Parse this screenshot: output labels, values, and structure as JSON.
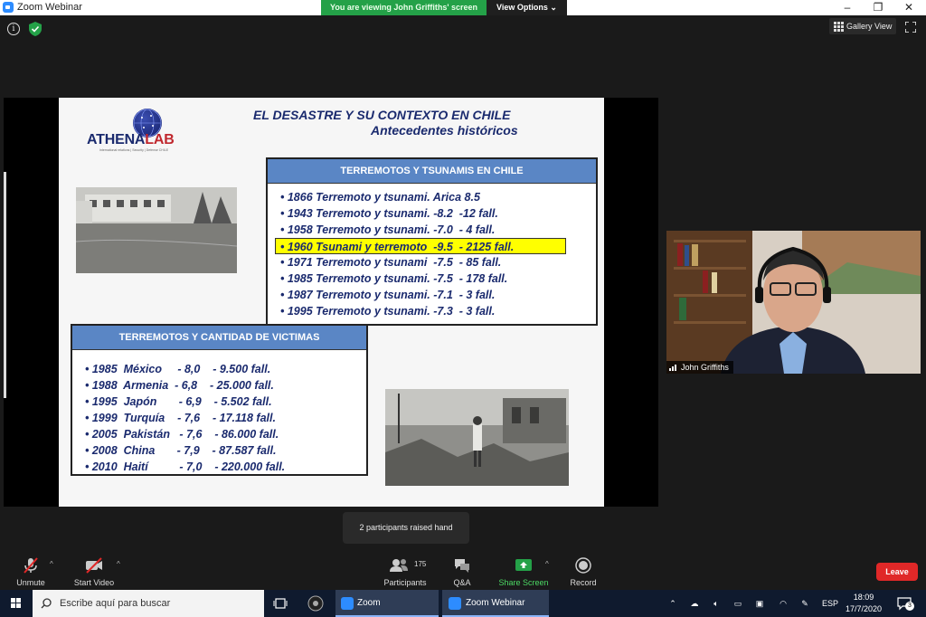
{
  "window": {
    "app_title": "Zoom Webinar",
    "viewing_banner": "You are viewing John Griffiths' screen",
    "view_options": "View Options ⌄",
    "minimize": "–",
    "restore": "❐",
    "close": "✕"
  },
  "top_controls": {
    "info": "i",
    "gallery_view": "Gallery View"
  },
  "slide": {
    "logo_main": "ATHENA",
    "logo_accent": "LAB",
    "logo_tagline": "International relations | Security | Defense CHILE",
    "title": "EL DESASTRE Y SU CONTEXTO EN CHILE",
    "subtitle": "Antecedentes históricos",
    "chile_box": {
      "header": "TERREMOTOS Y TSUNAMIS EN CHILE",
      "items": [
        "• 1866 Terremoto y tsunami. Arica 8.5",
        "• 1943 Terremoto y tsunami. -8.2  -12 fall.",
        "• 1958 Terremoto y tsunami. -7.0  - 4 fall.",
        "• 1960 Tsunami y terremoto  -9.5  - 2125 fall.",
        "• 1971 Terremoto y tsunami  -7.5  - 85 fall.",
        "• 1985 Terremoto y tsunami. -7.5  - 178 fall.",
        "• 1987 Terremoto y tsunami. -7.1  - 3 fall.",
        "• 1995 Terremoto y tsunami. -7.3  - 3 fall."
      ]
    },
    "victims_box": {
      "header": "TERREMOTOS Y CANTIDAD DE VICTIMAS",
      "items": [
        "• 1985  México     - 8,0    - 9.500 fall.",
        "• 1988  Armenia  - 6,8    - 25.000 fall.",
        "• 1995  Japón       - 6,9    - 5.502 fall.",
        "• 1999  Turquía    - 7,6    - 17.118 fall.",
        "• 2005  Pakistán   - 7,6    - 86.000 fall.",
        "• 2008  China       - 7,9    - 87.587 fall.",
        "• 2010  Haití          - 7,0    - 220.000 fall."
      ]
    }
  },
  "participant": {
    "name": "John Griffiths"
  },
  "toast": "2 participants raised hand",
  "toolbar": {
    "unmute": "Unmute",
    "start_video": "Start Video",
    "participants_count": "175",
    "participants": "Participants",
    "qa": "Q&A",
    "share_screen": "Share Screen",
    "record": "Record",
    "leave": "Leave",
    "caret": "^"
  },
  "taskbar": {
    "search_placeholder": "Escribe aquí para buscar",
    "zoom": "Zoom",
    "zoom_webinar": "Zoom Webinar",
    "language": "ESP",
    "time": "18:09",
    "date": "17/7/2020",
    "notification_count": "3"
  },
  "colors": {
    "banner_green": "#24a148",
    "leave_red": "#e02828",
    "slide_navy": "#1a2a6e",
    "box_header_blue": "#5a86c5",
    "highlight_yellow": "#ffff00"
  }
}
